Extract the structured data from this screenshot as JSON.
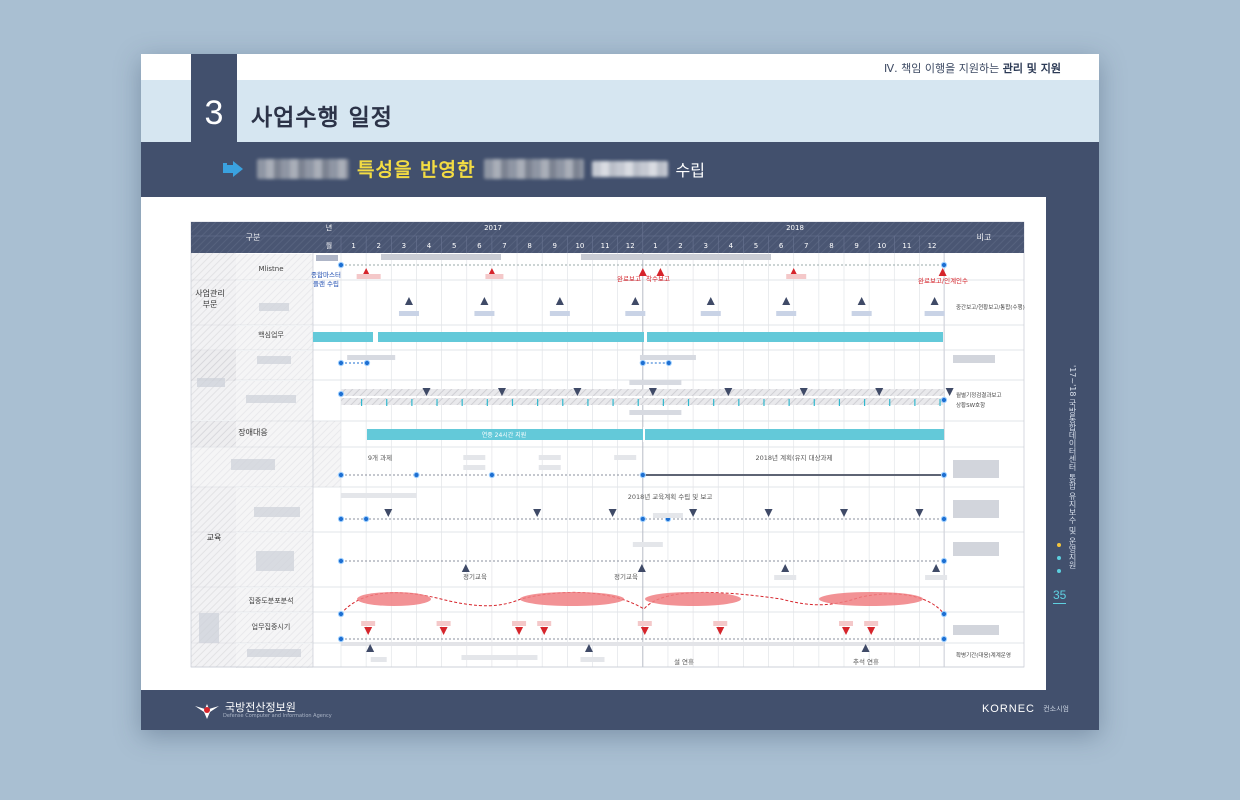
{
  "header": {
    "breadcrumb_prefix": "Ⅳ. 책임 이행을 지원하는 ",
    "breadcrumb_bold": "관리 및 지원",
    "section_number": "3",
    "title": "사업수행 일정"
  },
  "subtitle": {
    "part1": "특성을 반영한",
    "part2": "수립"
  },
  "table": {
    "col_category": "구분",
    "col_year": "년",
    "col_month": "월",
    "col_note": "비고",
    "years": [
      "2017",
      "2018"
    ],
    "months": [
      "1",
      "2",
      "3",
      "4",
      "5",
      "6",
      "7",
      "8",
      "9",
      "10",
      "11",
      "12",
      "1",
      "2",
      "3",
      "4",
      "5",
      "6",
      "7",
      "8",
      "9",
      "10",
      "11",
      "12"
    ],
    "groups": [
      {
        "label": "사업관리\n부문"
      },
      {
        "label": "장애대응"
      },
      {
        "label": "교육"
      }
    ],
    "row_labels": {
      "milestone": "Mlistne",
      "core_task": "핵심업무",
      "incident": "장애대응",
      "analysis": "집중도분포분석",
      "intensive": "업무집중시기"
    },
    "annotations": {
      "ms_start_1": "종합마스터",
      "ms_start_2": "플랜 수립",
      "ms_done": "완료보고",
      "ms_begin": "착수보고",
      "ms_end": "완료보고/인계인수",
      "incident_bar": "연중 24시간 지원",
      "tasks_9": "9개 과제",
      "tasks_2018": "2018년 계획(유지 대상과제",
      "edu_plan": "2018년 교육계획 수립 및 보고",
      "regular_edu_1": "정기교육",
      "regular_edu_2": "정기교육",
      "holiday_1": "설 연휴",
      "holiday_2": "추석 연휴"
    },
    "notes": {
      "n1": "중간보고/현황보고/통합(수행)",
      "n2a": "월별기정검결과보고",
      "n2b": "상황SW호항",
      "n3": "확병기간(대응)계계운영"
    }
  },
  "right_rail": {
    "vertical_text": "'17~'18 국방통합데이터센터 통합 유지보수 및 운영지원",
    "page_number": "35"
  },
  "footer": {
    "agency": "국방전산정보원",
    "agency_sub": "Defense Computer and Information Agency",
    "logo": "KORNEC",
    "logo_sub": "컨소시엄"
  },
  "colors": {
    "navy": "#42506d",
    "cyan": "#5ccfdf",
    "red": "#d6242b",
    "blue_dot": "#1e6fd1",
    "yellow": "#f3dc43"
  }
}
